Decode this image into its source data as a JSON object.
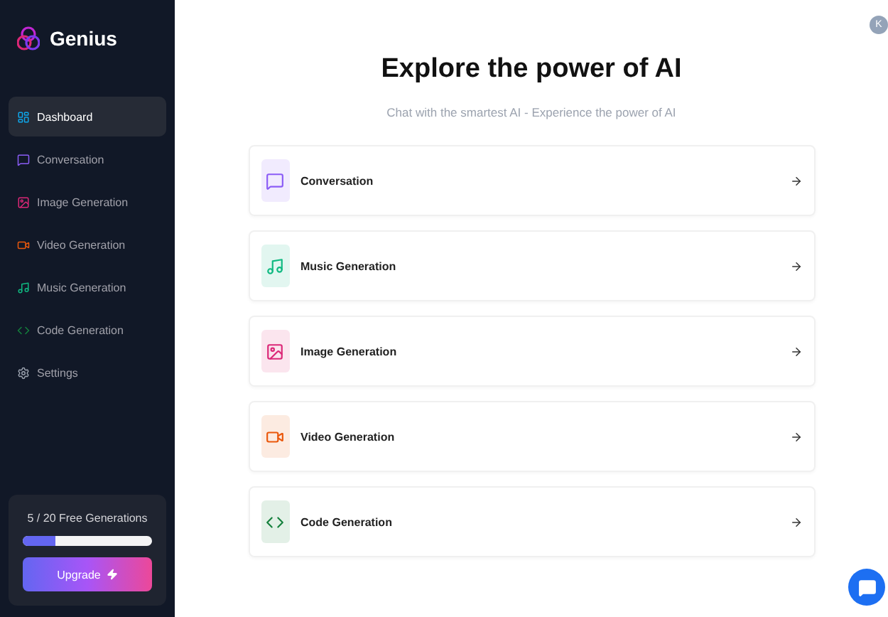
{
  "sidebar": {
    "logo": "Genius",
    "items": [
      {
        "label": "Dashboard",
        "kind": "dashboard",
        "color": "#0ea5e9",
        "selected": true
      },
      {
        "label": "Conversation",
        "kind": "conversation",
        "color": "#8b5cf6",
        "selected": false
      },
      {
        "label": "Image Generation",
        "kind": "image",
        "color": "#db2777",
        "selected": false
      },
      {
        "label": "Video Generation",
        "kind": "video",
        "color": "#ea580c",
        "selected": false
      },
      {
        "label": "Music Generation",
        "kind": "music",
        "color": "#10b981",
        "selected": false
      },
      {
        "label": "Code Generation",
        "kind": "code",
        "color": "#15803d",
        "selected": false
      },
      {
        "label": "Settings",
        "kind": "settings",
        "color": "#9ca3af",
        "selected": false
      }
    ],
    "usage": {
      "text": "5 / 20 Free Generations",
      "level": 0.25
    },
    "upgrade": "Upgrade"
  },
  "avatar": "K",
  "main": {
    "title": "Explore the power of AI",
    "subtitle": "Chat with the smartest AI - Experience the power of AI",
    "tools": [
      {
        "label": "Conversation",
        "kind": "conversation",
        "color": "#8b5cf6"
      },
      {
        "label": "Music Generation",
        "kind": "music",
        "color": "#10b981"
      },
      {
        "label": "Image Generation",
        "kind": "image",
        "color": "#db2777"
      },
      {
        "label": "Video Generation",
        "kind": "video",
        "color": "#ea580c"
      },
      {
        "label": "Code Generation",
        "kind": "code",
        "color": "#15803d"
      }
    ]
  }
}
